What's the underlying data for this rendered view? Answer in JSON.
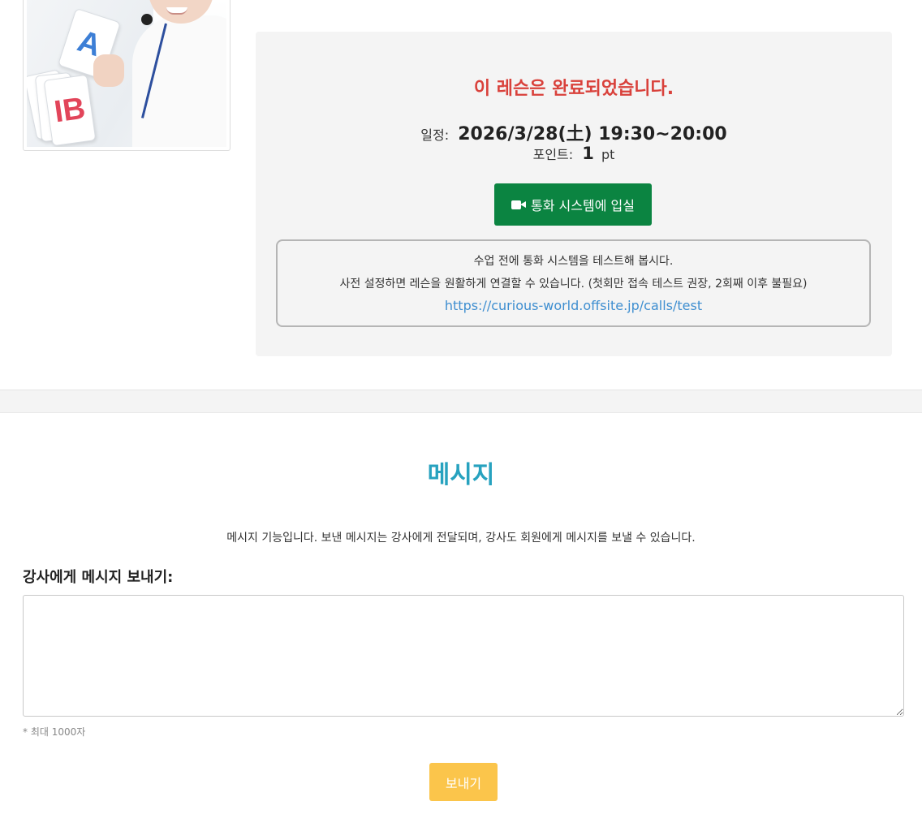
{
  "lesson": {
    "status_text": "이 레슨은 완료되었습니다.",
    "schedule_label": "일정:",
    "schedule_value": "2026/3/28(土) 19:30~20:00",
    "points_label": "포인트:",
    "points_value": "1",
    "points_unit": "pt",
    "enter_call_label": "통화 시스템에 입실",
    "test": {
      "line1": "수업 전에 통화 시스템을 테스트해 봅시다.",
      "line2": "사전 설정하면 레슨을 원활하게 연결할 수 있습니다. (첫회만 접속 테스트 권장, 2회째 이후 불필요)",
      "link_text": "https://curious-world.offsite.jp/calls/test"
    }
  },
  "photo": {
    "card_a": "A",
    "card_b": "IB"
  },
  "message": {
    "title": "메시지",
    "description": "메시지 기능입니다. 보낸 메시지는 강사에게 전달되며, 강사도 회원에게 메시지를 보낼 수 있습니다.",
    "label": "강사에게 메시지 보내기:",
    "textarea_value": "",
    "textarea_placeholder": "",
    "char_limit": "* 최대 1000자",
    "send_label": "보내기"
  },
  "colors": {
    "status_red": "#d9413b",
    "call_button_green": "#0b8441",
    "link_blue": "#3e8ed0",
    "title_teal": "#27a2bf",
    "send_button_yellow": "#fbc54b",
    "panel_gray": "#f4f4f4"
  },
  "icons": {
    "call_button_icon": "video-camera-icon"
  }
}
